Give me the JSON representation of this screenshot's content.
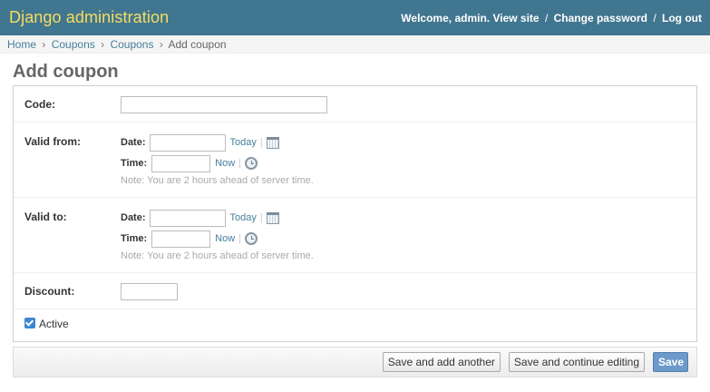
{
  "header": {
    "title": "Django administration",
    "welcome": "Welcome,",
    "username": "admin",
    "links": [
      "View site",
      "Change password",
      "Log out"
    ]
  },
  "breadcrumbs": [
    "Home",
    "Coupons",
    "Coupons",
    "Add coupon"
  ],
  "page": {
    "title": "Add coupon"
  },
  "form": {
    "code": {
      "label": "Code:",
      "value": ""
    },
    "valid_from": {
      "label": "Valid from:",
      "date_label": "Date:",
      "date_value": "",
      "today_link": "Today",
      "time_label": "Time:",
      "time_value": "",
      "now_link": "Now",
      "note": "Note: You are 2 hours ahead of server time."
    },
    "valid_to": {
      "label": "Valid to:",
      "date_label": "Date:",
      "date_value": "",
      "today_link": "Today",
      "time_label": "Time:",
      "time_value": "",
      "now_link": "Now",
      "note": "Note: You are 2 hours ahead of server time."
    },
    "discount": {
      "label": "Discount:",
      "value": ""
    },
    "active": {
      "label": "Active",
      "checked": true
    }
  },
  "buttons": {
    "save_add_another": "Save and add another",
    "save_continue": "Save and continue editing",
    "save": "Save"
  },
  "icons": {
    "calendar": "calendar-icon",
    "clock": "clock-icon"
  }
}
